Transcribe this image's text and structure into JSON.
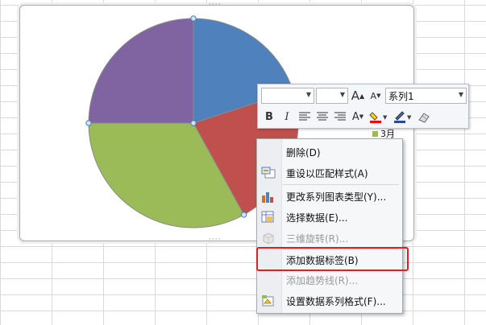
{
  "chart_data": {
    "type": "pie",
    "slices": [
      {
        "color": "#4f81bd",
        "value": 20
      },
      {
        "color": "#c0504d",
        "value": 22
      },
      {
        "color": "#9bbb59",
        "value": 33
      },
      {
        "color": "#8064a2",
        "value": 25
      }
    ]
  },
  "toolbar": {
    "series_select": "系列1",
    "font_grow_icon": "increase-font-icon",
    "font_shrink_icon": "decrease-font-icon",
    "bold": "B",
    "italic": "I",
    "font_color": "A"
  },
  "legend": {
    "label": "3月",
    "color": "#9bbb59"
  },
  "context_menu": {
    "items": [
      {
        "label": "删除(D)",
        "icon": "none",
        "enabled": true
      },
      {
        "label": "重设以匹配样式(A)",
        "icon": "reset-style-icon",
        "enabled": true
      },
      {
        "label": "更改系列图表类型(Y)...",
        "icon": "chart-type-icon",
        "enabled": true
      },
      {
        "label": "选择数据(E)...",
        "icon": "select-data-icon",
        "enabled": true
      },
      {
        "label": "三维旋转(R)...",
        "icon": "rotate-3d-icon",
        "enabled": false
      },
      {
        "label": "添加数据标签(B)",
        "icon": "none",
        "enabled": true
      },
      {
        "label": "添加趋势线(R)...",
        "icon": "none",
        "enabled": false
      },
      {
        "label": "设置数据系列格式(F)...",
        "icon": "format-series-icon",
        "enabled": true
      }
    ]
  }
}
